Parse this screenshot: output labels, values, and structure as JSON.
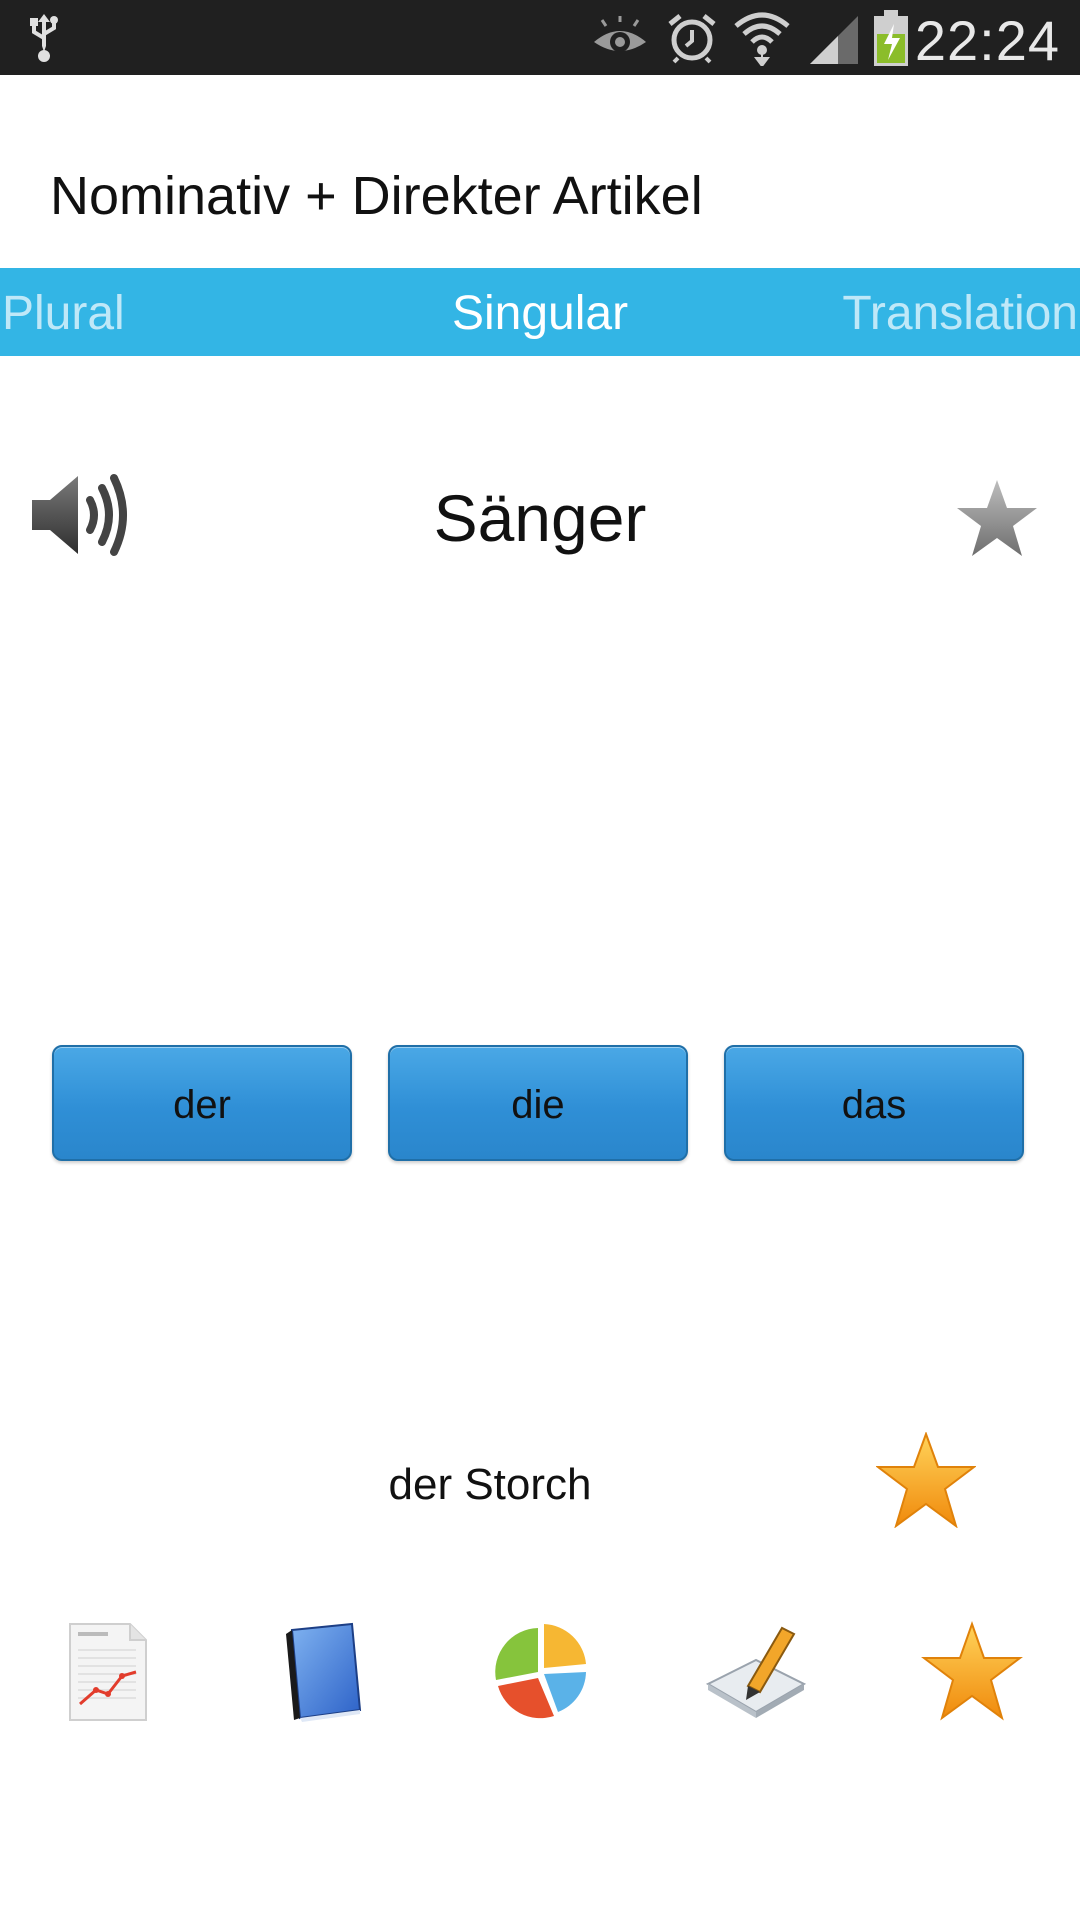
{
  "status_bar": {
    "time": "22:24",
    "icons": [
      "usb-icon",
      "eye-icon",
      "alarm-icon",
      "wifi-icon",
      "signal-icon",
      "battery-charging-icon"
    ]
  },
  "header": {
    "title": "Nominativ + Direkter Artikel"
  },
  "tabs": [
    {
      "label": "Plural",
      "active": false
    },
    {
      "label": "Singular",
      "active": true
    },
    {
      "label": "Translation",
      "active": false
    }
  ],
  "card": {
    "word": "Sänger",
    "speaker_icon": "speaker-icon",
    "favorite_icon": "star-gray-icon"
  },
  "articles": {
    "der": "der",
    "die": "die",
    "das": "das"
  },
  "last_answer": {
    "text": "der Storch",
    "icon": "star-gold-icon"
  },
  "toolbar": {
    "items": [
      "report-icon",
      "book-icon",
      "pie-chart-icon",
      "edit-icon",
      "favorites-star-icon"
    ]
  },
  "colors": {
    "status_bar": "#202020",
    "tab_bar": "#33b5e5",
    "button": "#2f8fd6",
    "gold_star": "#f6a21a"
  }
}
